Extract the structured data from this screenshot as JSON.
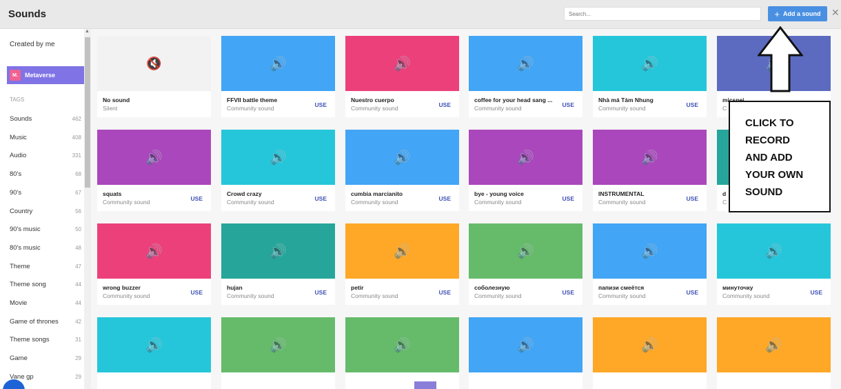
{
  "header": {
    "title": "Sounds",
    "search_placeholder": "Search...",
    "add_button_label": "Add a sound",
    "plus_glyph": "+",
    "close_glyph": "✕"
  },
  "sidebar": {
    "created_by_me": "Created by me",
    "metaverse_label": "Metaverse",
    "metaverse_logo": "M.",
    "tags_heading": "TAGS",
    "tags": [
      {
        "label": "Sounds",
        "count": "462"
      },
      {
        "label": "Music",
        "count": "408"
      },
      {
        "label": "Audio",
        "count": "331"
      },
      {
        "label": "80's",
        "count": "68"
      },
      {
        "label": "90's",
        "count": "67"
      },
      {
        "label": "Country",
        "count": "56"
      },
      {
        "label": "90's music",
        "count": "50"
      },
      {
        "label": "80's music",
        "count": "48"
      },
      {
        "label": "Theme",
        "count": "47"
      },
      {
        "label": "Theme song",
        "count": "44"
      },
      {
        "label": "Movie",
        "count": "44"
      },
      {
        "label": "Game of thrones",
        "count": "42"
      },
      {
        "label": "Theme songs",
        "count": "31"
      },
      {
        "label": "Game",
        "count": "29"
      },
      {
        "label": "Vane gp",
        "count": "29"
      }
    ]
  },
  "use_label": "USE",
  "icons": {
    "speaker": "speaker-icon",
    "muted": "mute-icon"
  },
  "sounds": [
    {
      "name": "No sound",
      "subtitle": "Silent",
      "color": "#f2f2f2",
      "silent": true
    },
    {
      "name": "FFVII battle theme",
      "subtitle": "Community sound",
      "color": "#42a5f5"
    },
    {
      "name": "Nuestro cuerpo",
      "subtitle": "Community sound",
      "color": "#ec407a"
    },
    {
      "name": "coffee for your head sang ...",
      "subtitle": "Community sound",
      "color": "#42a5f5"
    },
    {
      "name": "Nhà má Tám Nhung",
      "subtitle": "Community sound",
      "color": "#26c6da"
    },
    {
      "name": "micspei",
      "subtitle": "C",
      "color": "#5c6bc0"
    },
    {
      "name": "squats",
      "subtitle": "Community sound",
      "color": "#ab47bc"
    },
    {
      "name": "Crowd crazy",
      "subtitle": "Community sound",
      "color": "#26c6da"
    },
    {
      "name": "cumbia marcianito",
      "subtitle": "Community sound",
      "color": "#42a5f5"
    },
    {
      "name": "bye - young voice",
      "subtitle": "Community sound",
      "color": "#ab47bc"
    },
    {
      "name": "INSTRUMENTAL",
      "subtitle": "Community sound",
      "color": "#ab47bc"
    },
    {
      "name": "d",
      "subtitle": "C",
      "color": "#26a69a"
    },
    {
      "name": "wrong buzzer",
      "subtitle": "Community sound",
      "color": "#ec407a"
    },
    {
      "name": "hujan",
      "subtitle": "Community sound",
      "color": "#26a69a"
    },
    {
      "name": "petir",
      "subtitle": "Community sound",
      "color": "#ffa726"
    },
    {
      "name": "соболезную",
      "subtitle": "Community sound",
      "color": "#66bb6a"
    },
    {
      "name": "папизи смеётся",
      "subtitle": "Community sound",
      "color": "#42a5f5"
    },
    {
      "name": "минуточку",
      "subtitle": "Community sound",
      "color": "#26c6da"
    },
    {
      "name": "",
      "subtitle": "",
      "color": "#26c6da"
    },
    {
      "name": "",
      "subtitle": "",
      "color": "#66bb6a"
    },
    {
      "name": "",
      "subtitle": "",
      "color": "#66bb6a"
    },
    {
      "name": "",
      "subtitle": "",
      "color": "#42a5f5"
    },
    {
      "name": "",
      "subtitle": "",
      "color": "#ffa726"
    },
    {
      "name": "",
      "subtitle": "",
      "color": "#ffa726"
    }
  ],
  "callout": {
    "text": "CLICK TO\nRECORD\nAND ADD\nYOUR OWN\nSOUND"
  }
}
